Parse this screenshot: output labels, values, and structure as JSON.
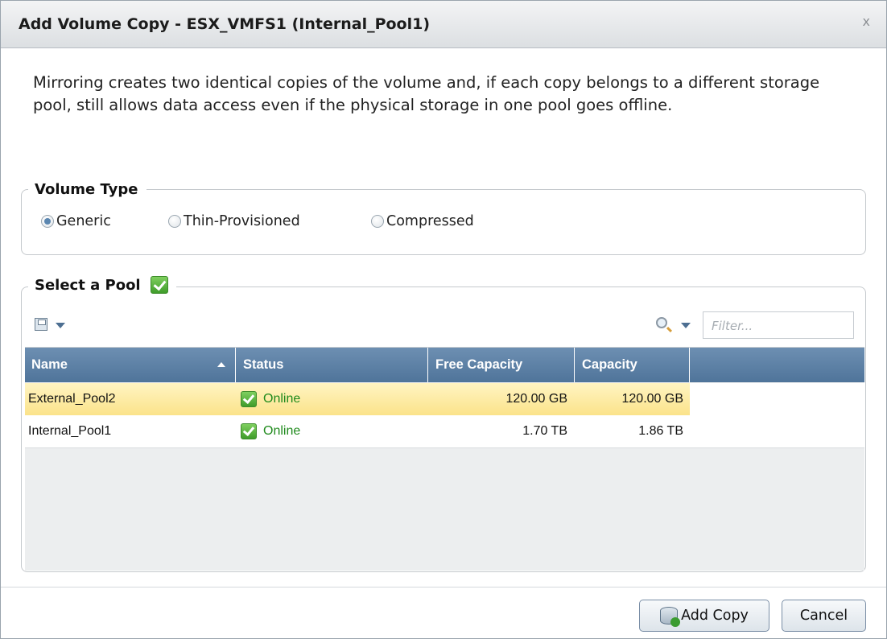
{
  "dialog": {
    "title": "Add Volume Copy - ESX_VMFS1 (Internal_Pool1)",
    "close_glyph": "x",
    "description": "Mirroring creates two identical copies of the volume and, if each copy belongs to a different storage pool, still allows data access even if the physical storage in one pool goes offline."
  },
  "volume_type": {
    "legend": "Volume Type",
    "options": [
      {
        "label": "Generic",
        "selected": true
      },
      {
        "label": "Thin-Provisioned",
        "selected": false
      },
      {
        "label": "Compressed",
        "selected": false
      }
    ]
  },
  "pool_section": {
    "legend": "Select a Pool",
    "filter_placeholder": "Filter...",
    "columns": [
      "Name",
      "Status",
      "Free Capacity",
      "Capacity"
    ],
    "sorted_column": "Name",
    "sort_direction": "asc",
    "rows": [
      {
        "name": "External_Pool2",
        "status": "Online",
        "free_capacity": "120.00 GB",
        "capacity": "120.00 GB",
        "selected": true
      },
      {
        "name": "Internal_Pool1",
        "status": "Online",
        "free_capacity": "1.70 TB",
        "capacity": "1.86 TB",
        "selected": false
      }
    ]
  },
  "buttons": {
    "add_copy": "Add Copy",
    "cancel": "Cancel"
  },
  "colors": {
    "header_bg": "#5a7ea6",
    "selected_row": "#fbe38a",
    "status_online": "#1f8a1c"
  }
}
